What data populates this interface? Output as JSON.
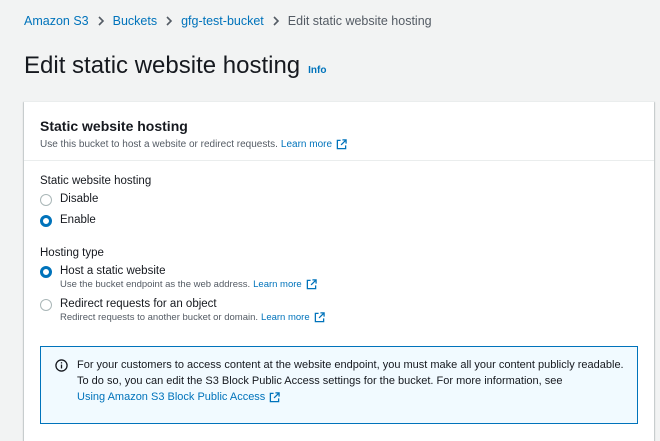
{
  "breadcrumb": {
    "items": [
      "Amazon S3",
      "Buckets",
      "gfg-test-bucket"
    ],
    "current": "Edit static website hosting"
  },
  "page": {
    "title": "Edit static website hosting",
    "info": "Info"
  },
  "panel": {
    "title": "Static website hosting",
    "description": "Use this bucket to host a website or redirect requests.",
    "learn_more": "Learn more"
  },
  "hosting": {
    "label": "Static website hosting",
    "options": [
      "Disable",
      "Enable"
    ],
    "selected": "Enable"
  },
  "hosting_type": {
    "label": "Hosting type",
    "selected": "Host a static website",
    "options": [
      {
        "label": "Host a static website",
        "desc": "Use the bucket endpoint as the web address.",
        "learn_more": "Learn more"
      },
      {
        "label": "Redirect requests for an object",
        "desc": "Redirect requests to another bucket or domain.",
        "learn_more": "Learn more"
      }
    ]
  },
  "alert": {
    "text": "For your customers to access content at the website endpoint, you must make all your content publicly readable. To do so, you can edit the S3 Block Public Access settings for the bucket. For more information, see",
    "link": "Using Amazon S3 Block Public Access"
  },
  "colors": {
    "link": "#0073bb",
    "background": "#f2f3f3",
    "alert_bg": "#f1faff"
  },
  "icons": [
    "chevron-right-icon",
    "external-link-icon",
    "info-circle-icon"
  ]
}
